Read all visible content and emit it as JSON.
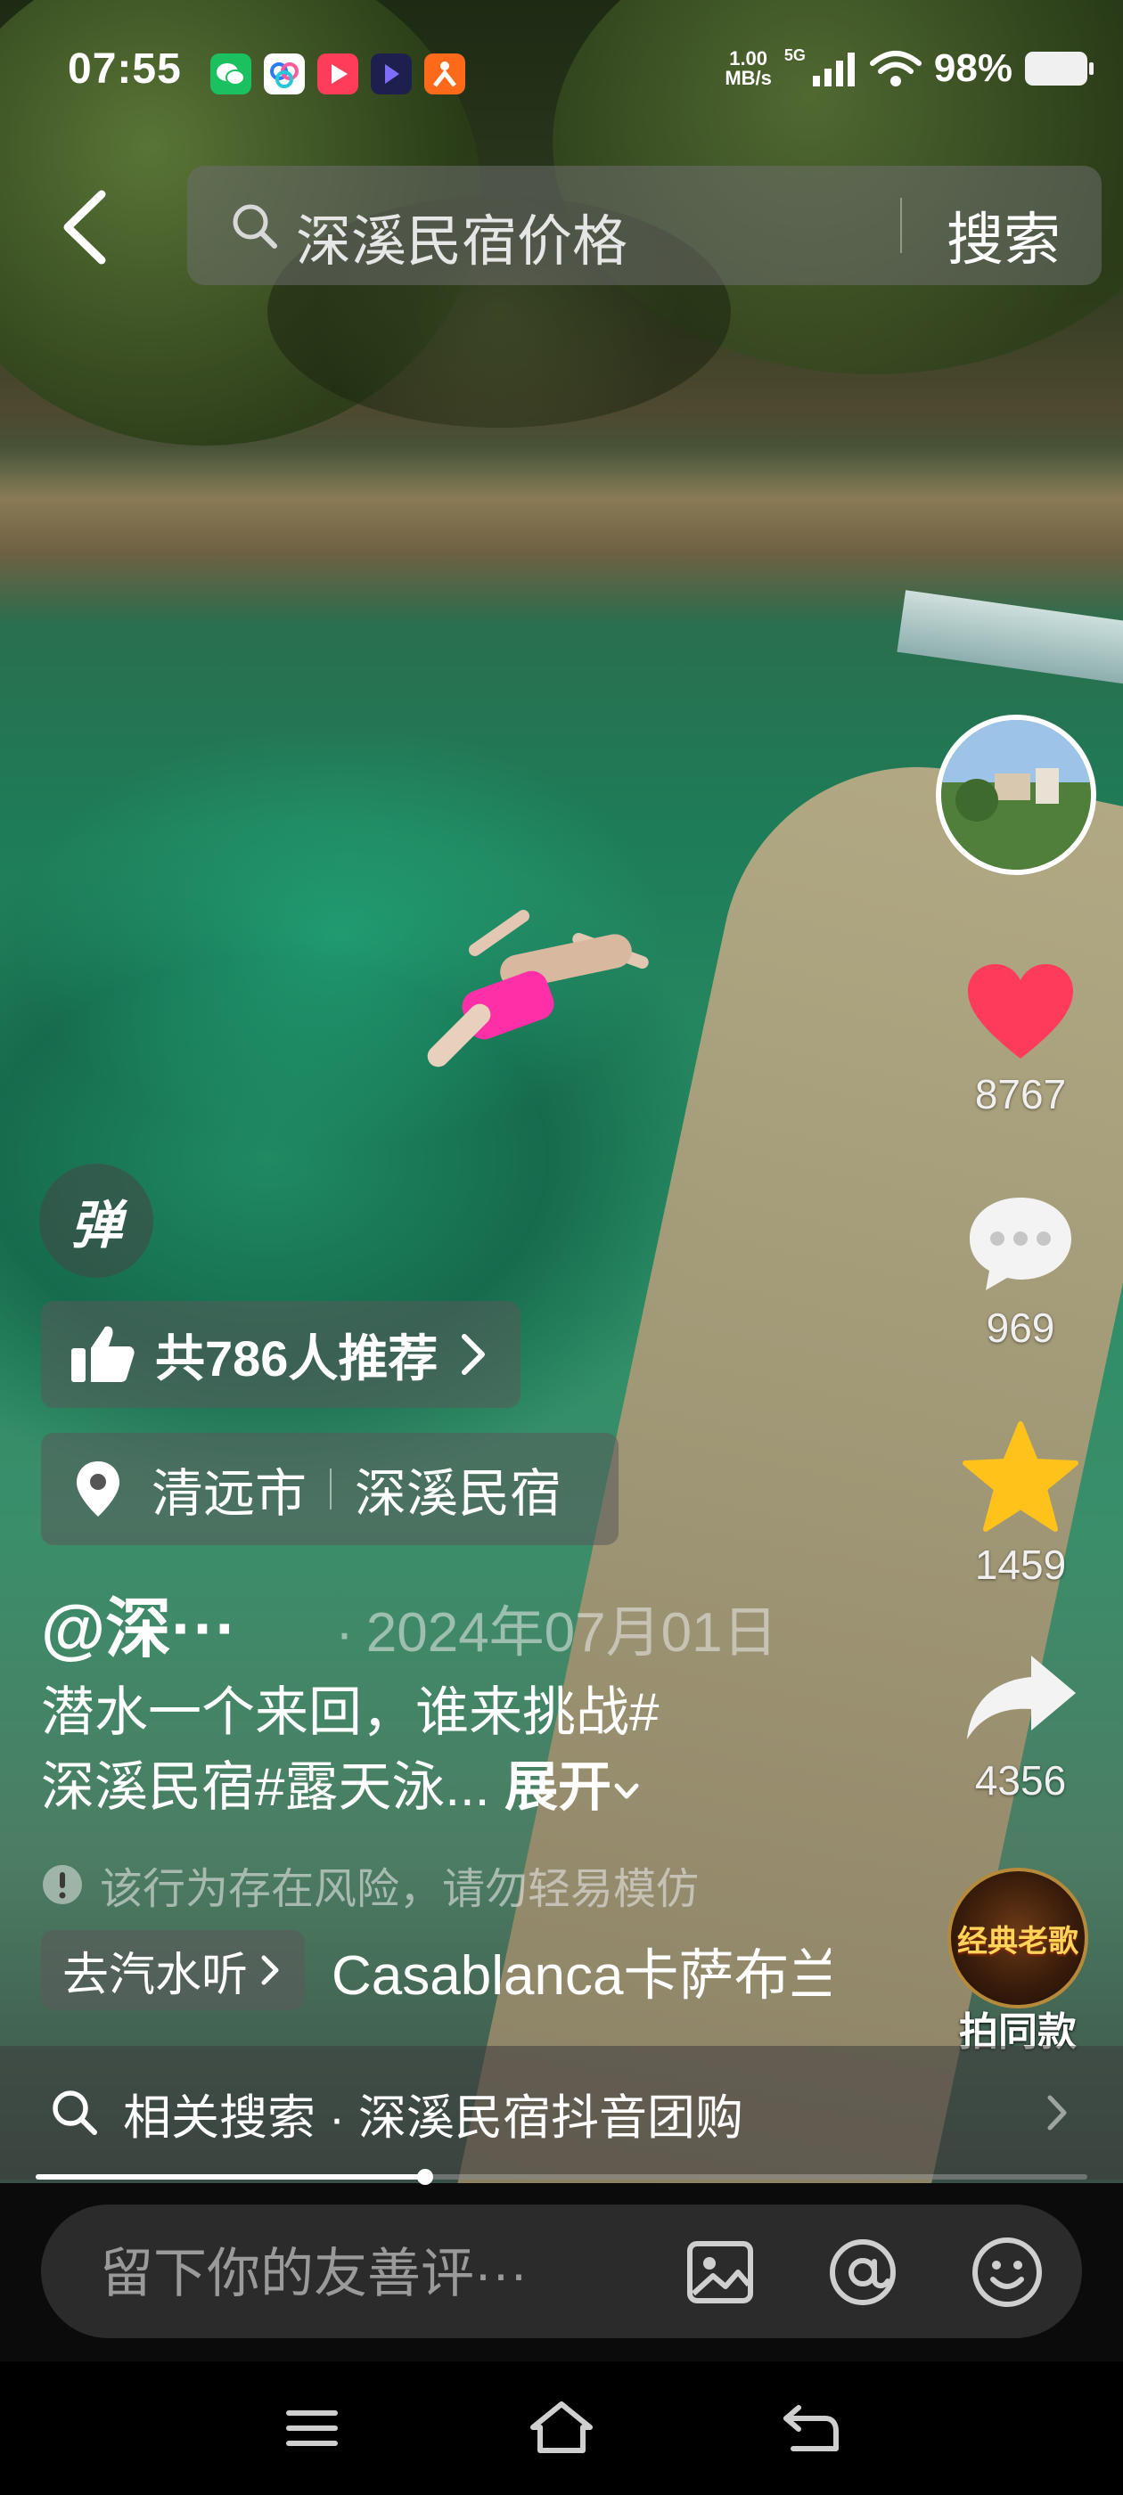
{
  "status_bar": {
    "time": "07:55",
    "net_speed_value": "1.00",
    "net_speed_unit": "MB/s",
    "network": "5G",
    "battery": "98%",
    "app_icons": [
      "wechat-icon",
      "baidu-netdisk-icon",
      "red-video-app-icon",
      "navy-video-app-icon",
      "orange-app-icon"
    ]
  },
  "search": {
    "query": "深溪民宿价格",
    "button": "搜索"
  },
  "actions": {
    "likes": "8767",
    "comments": "969",
    "favorites": "1459",
    "shares": "4356",
    "same_style_label": "拍同款",
    "same_style_art": "经典老歌"
  },
  "video": {
    "danmu": "弹",
    "recommend": "共786人推荐",
    "location_city": "清远市",
    "location_place": "深溪民宿",
    "author": "@深···",
    "date": "2024年07月01日",
    "caption_line1": "潜水一个来回，谁来挑战#",
    "caption_line2": "深溪民宿#露天泳...",
    "expand": "展开",
    "risk_notice": "该行为存在风险，请勿轻易模仿",
    "music_link": "去汽水听",
    "music_title": "Casablanca卡萨布兰卡",
    "progress": 0.37
  },
  "related": {
    "text": "相关搜索 · 深溪民宿抖音团购"
  },
  "comment": {
    "placeholder": "留下你的友善评···"
  },
  "colors": {
    "like_red": "#ff3b5c",
    "favorite_yellow": "#ffc21a",
    "music_pill": "#5a5a5a"
  }
}
